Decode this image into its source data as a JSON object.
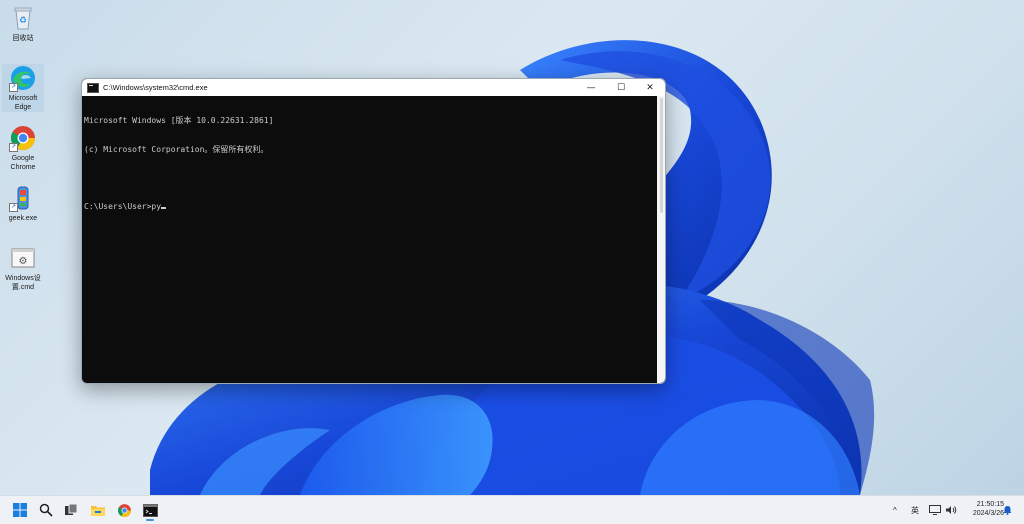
{
  "desktop": {
    "icons": [
      {
        "label": "回收站",
        "icon": "recycle-bin-icon"
      },
      {
        "label": "Microsoft Edge",
        "icon": "edge-icon"
      },
      {
        "label": "Google Chrome",
        "icon": "chrome-icon"
      },
      {
        "label": "geek.exe",
        "icon": "geek-icon"
      },
      {
        "label": "Windows设置.cmd",
        "icon": "settings-script-icon"
      }
    ]
  },
  "window": {
    "title": "C:\\Windows\\system32\\cmd.exe",
    "minimize": "—",
    "maximize": "☐",
    "close": "✕",
    "lines": [
      "Microsoft Windows [版本 10.0.22631.2861]",
      "(c) Microsoft Corporation。保留所有权利。",
      "",
      "C:\\Users\\User>py"
    ]
  },
  "taskbar": {
    "pinned": [
      "start-icon",
      "search-icon",
      "task-view-icon",
      "file-explorer-icon",
      "chrome-icon",
      "terminal-icon"
    ],
    "tray": {
      "chevron": "^",
      "ime": "英",
      "time": "21:50:15",
      "date": "2024/3/26"
    }
  },
  "colors": {
    "terminal_bg": "#0c0c0c",
    "terminal_fg": "#cccccc",
    "wallpaper_blue": "#1e5be6"
  }
}
